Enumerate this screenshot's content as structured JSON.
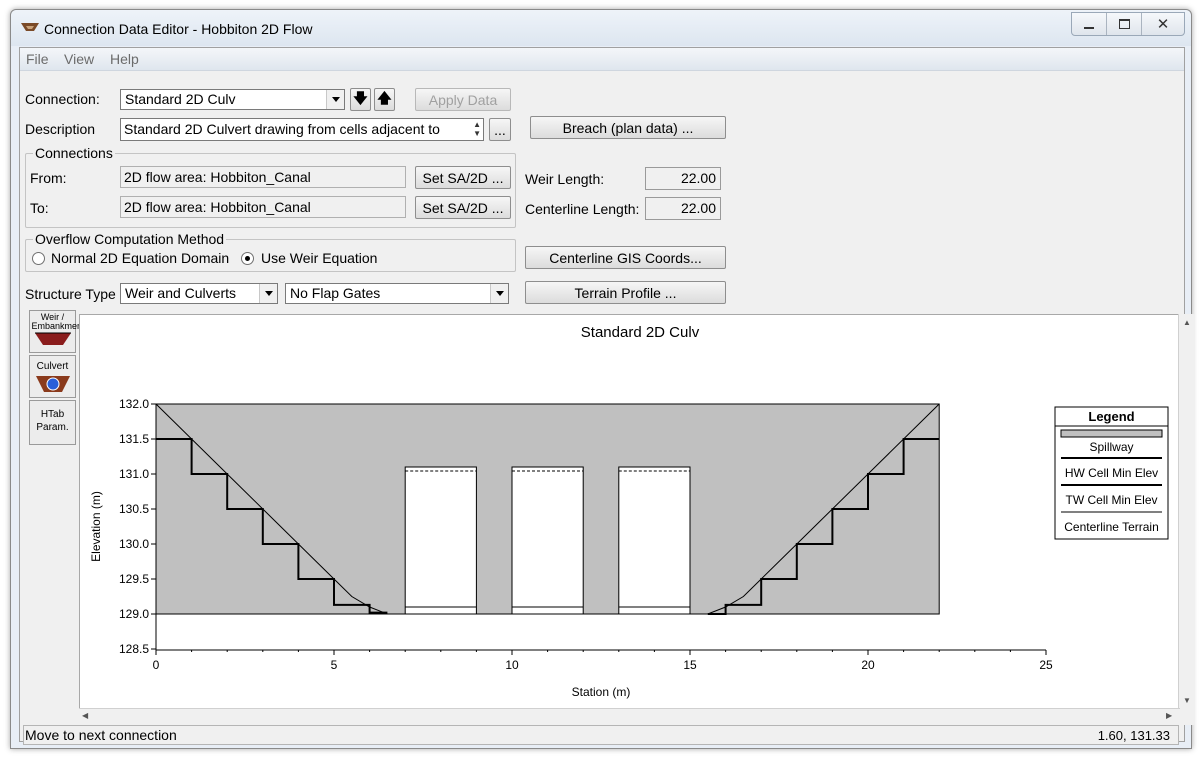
{
  "window": {
    "title": "Connection Data Editor - Hobbiton 2D Flow"
  },
  "menu": {
    "file": "File",
    "view": "View",
    "help": "Help"
  },
  "connection": {
    "label": "Connection:",
    "value": "Standard 2D Culv",
    "apply_label": "Apply Data"
  },
  "description": {
    "label": "Description",
    "value": "Standard 2D Culvert drawing from cells adjacent to",
    "more": "..."
  },
  "breach_label": "Breach (plan data) ...",
  "connections_group": {
    "title": "Connections",
    "from_label": "From:",
    "from_value": "2D flow area: Hobbiton_Canal",
    "to_label": "To:",
    "to_value": "2D flow area: Hobbiton_Canal",
    "set_label": "Set SA/2D ..."
  },
  "lengths": {
    "weir_label": "Weir Length:",
    "weir_value": "22.00",
    "centerline_label": "Centerline Length:",
    "centerline_value": "22.00"
  },
  "overflow": {
    "title": "Overflow Computation Method",
    "option1": "Normal 2D Equation Domain",
    "option2": "Use Weir Equation",
    "selected": 2
  },
  "gis_label": "Centerline GIS Coords...",
  "terrain_label": "Terrain Profile ...",
  "structure": {
    "label": "Structure Type",
    "type": "Weir and Culverts",
    "flap": "No Flap Gates"
  },
  "side_tabs": {
    "weir": "Weir / Embankment",
    "culvert": "Culvert",
    "htab1": "HTab",
    "htab2": "Param."
  },
  "chart_data": {
    "type": "line",
    "title": "Standard 2D Culv",
    "xlabel": "Station (m)",
    "ylabel": "Elevation (m)",
    "xlim": [
      0,
      25
    ],
    "ylim": [
      128.5,
      132.0
    ],
    "xticks": [
      "0",
      "5",
      "10",
      "15",
      "20",
      "25"
    ],
    "yticks": [
      "128.5",
      "129.0",
      "129.5",
      "130.0",
      "130.5",
      "131.0",
      "131.5",
      "132.0"
    ],
    "spillway": {
      "x": [
        0,
        22
      ],
      "top": 132.0,
      "bottom": 129.0
    },
    "culverts": [
      {
        "x0": 7.0,
        "x1": 9.0,
        "invert": 129.1,
        "top": 131.1
      },
      {
        "x0": 10.0,
        "x1": 12.0,
        "invert": 129.1,
        "top": 131.1
      },
      {
        "x0": 13.0,
        "x1": 15.0,
        "invert": 129.1,
        "top": 131.1
      }
    ],
    "hw_cell_min_elev": [
      {
        "x0": 0,
        "x1": 1,
        "y": 131.5
      },
      {
        "x0": 1,
        "x1": 2,
        "y": 131.0
      },
      {
        "x0": 2,
        "x1": 3,
        "y": 130.5
      },
      {
        "x0": 3,
        "x1": 4,
        "y": 130.0
      },
      {
        "x0": 4,
        "x1": 5,
        "y": 129.5
      },
      {
        "x0": 5,
        "x1": 6,
        "y": 129.13
      },
      {
        "x0": 6,
        "x1": 6.5,
        "y": 129.02
      }
    ],
    "tw_cell_min_elev": [
      {
        "x0": 15.5,
        "x1": 16,
        "y": 129.0
      },
      {
        "x0": 16,
        "x1": 17,
        "y": 129.13
      },
      {
        "x0": 17,
        "x1": 18,
        "y": 129.5
      },
      {
        "x0": 18,
        "x1": 19,
        "y": 130.0
      },
      {
        "x0": 19,
        "x1": 20,
        "y": 130.5
      },
      {
        "x0": 20,
        "x1": 21,
        "y": 131.0
      },
      {
        "x0": 21,
        "x1": 22,
        "y": 131.5
      }
    ],
    "centerline_terrain": {
      "x": [
        0,
        1,
        2,
        3,
        4,
        5,
        5.5,
        6,
        6.5,
        7,
        15,
        15.5,
        16,
        16.5,
        17,
        18,
        19,
        20,
        21,
        22
      ],
      "y": [
        132.0,
        131.5,
        131.0,
        130.5,
        130.0,
        129.5,
        129.25,
        129.1,
        129.0,
        129.0,
        129.0,
        129.0,
        129.1,
        129.25,
        129.5,
        130.0,
        130.5,
        131.0,
        131.5,
        132.0
      ]
    },
    "legend": {
      "title": "Legend",
      "entries": [
        "Spillway",
        "HW Cell Min Elev",
        "TW Cell Min Elev",
        "Centerline Terrain"
      ],
      "position": "right"
    }
  },
  "status": {
    "message": "Move to next connection",
    "coords": "1.60, 131.33"
  }
}
